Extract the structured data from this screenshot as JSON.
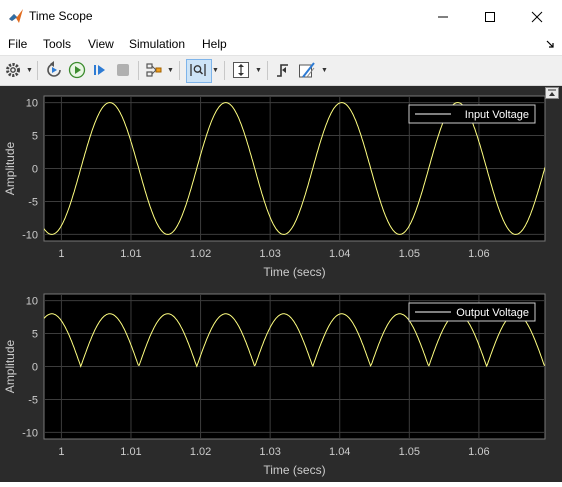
{
  "window": {
    "title": "Time Scope"
  },
  "menu": [
    {
      "label": "File"
    },
    {
      "label": "Tools"
    },
    {
      "label": "View"
    },
    {
      "label": "Simulation"
    },
    {
      "label": "Help"
    }
  ],
  "colors": {
    "plot_bg": "#000000",
    "figure_bg": "#2b2b2b",
    "signal": "#ffff80",
    "axis_text": "#cccccc",
    "grid": "#3c3c3c"
  },
  "toolbar": [
    "gear-icon",
    "step-back-icon",
    "run-icon",
    "step-forward-icon",
    "stop-icon",
    "highlight-icon",
    "zoom-icon",
    "scale-axes-icon",
    "triggers-icon",
    "cursor-measurements-icon"
  ],
  "chart_data": [
    {
      "type": "line",
      "ylabel": "Amplitude",
      "xlabel": "Time (secs)",
      "xlim": [
        0.9975,
        1.0695
      ],
      "ylim": [
        -11,
        11
      ],
      "xticks": [
        "1",
        "1.01",
        "1.02",
        "1.03",
        "1.04",
        "1.05",
        "1.06"
      ],
      "yticks": [
        "10",
        "5",
        "0",
        "-5",
        "-10"
      ],
      "legend": "top-right",
      "grid": true,
      "series": [
        {
          "name": "Input Voltage",
          "waveform": "sine",
          "amplitude": 10,
          "frequency_hz": 60,
          "offset": 0
        }
      ]
    },
    {
      "type": "line",
      "ylabel": "Amplitude",
      "xlabel": "Time (secs)",
      "xlim": [
        0.9975,
        1.0695
      ],
      "ylim": [
        -11,
        11
      ],
      "xticks": [
        "1",
        "1.01",
        "1.02",
        "1.03",
        "1.04",
        "1.05",
        "1.06"
      ],
      "yticks": [
        "10",
        "5",
        "0",
        "-5",
        "-10"
      ],
      "legend": "top-right",
      "grid": true,
      "series": [
        {
          "name": "Output Voltage",
          "waveform": "full-wave rectified sine",
          "peak": 8,
          "frequency_hz": 60
        }
      ]
    }
  ]
}
